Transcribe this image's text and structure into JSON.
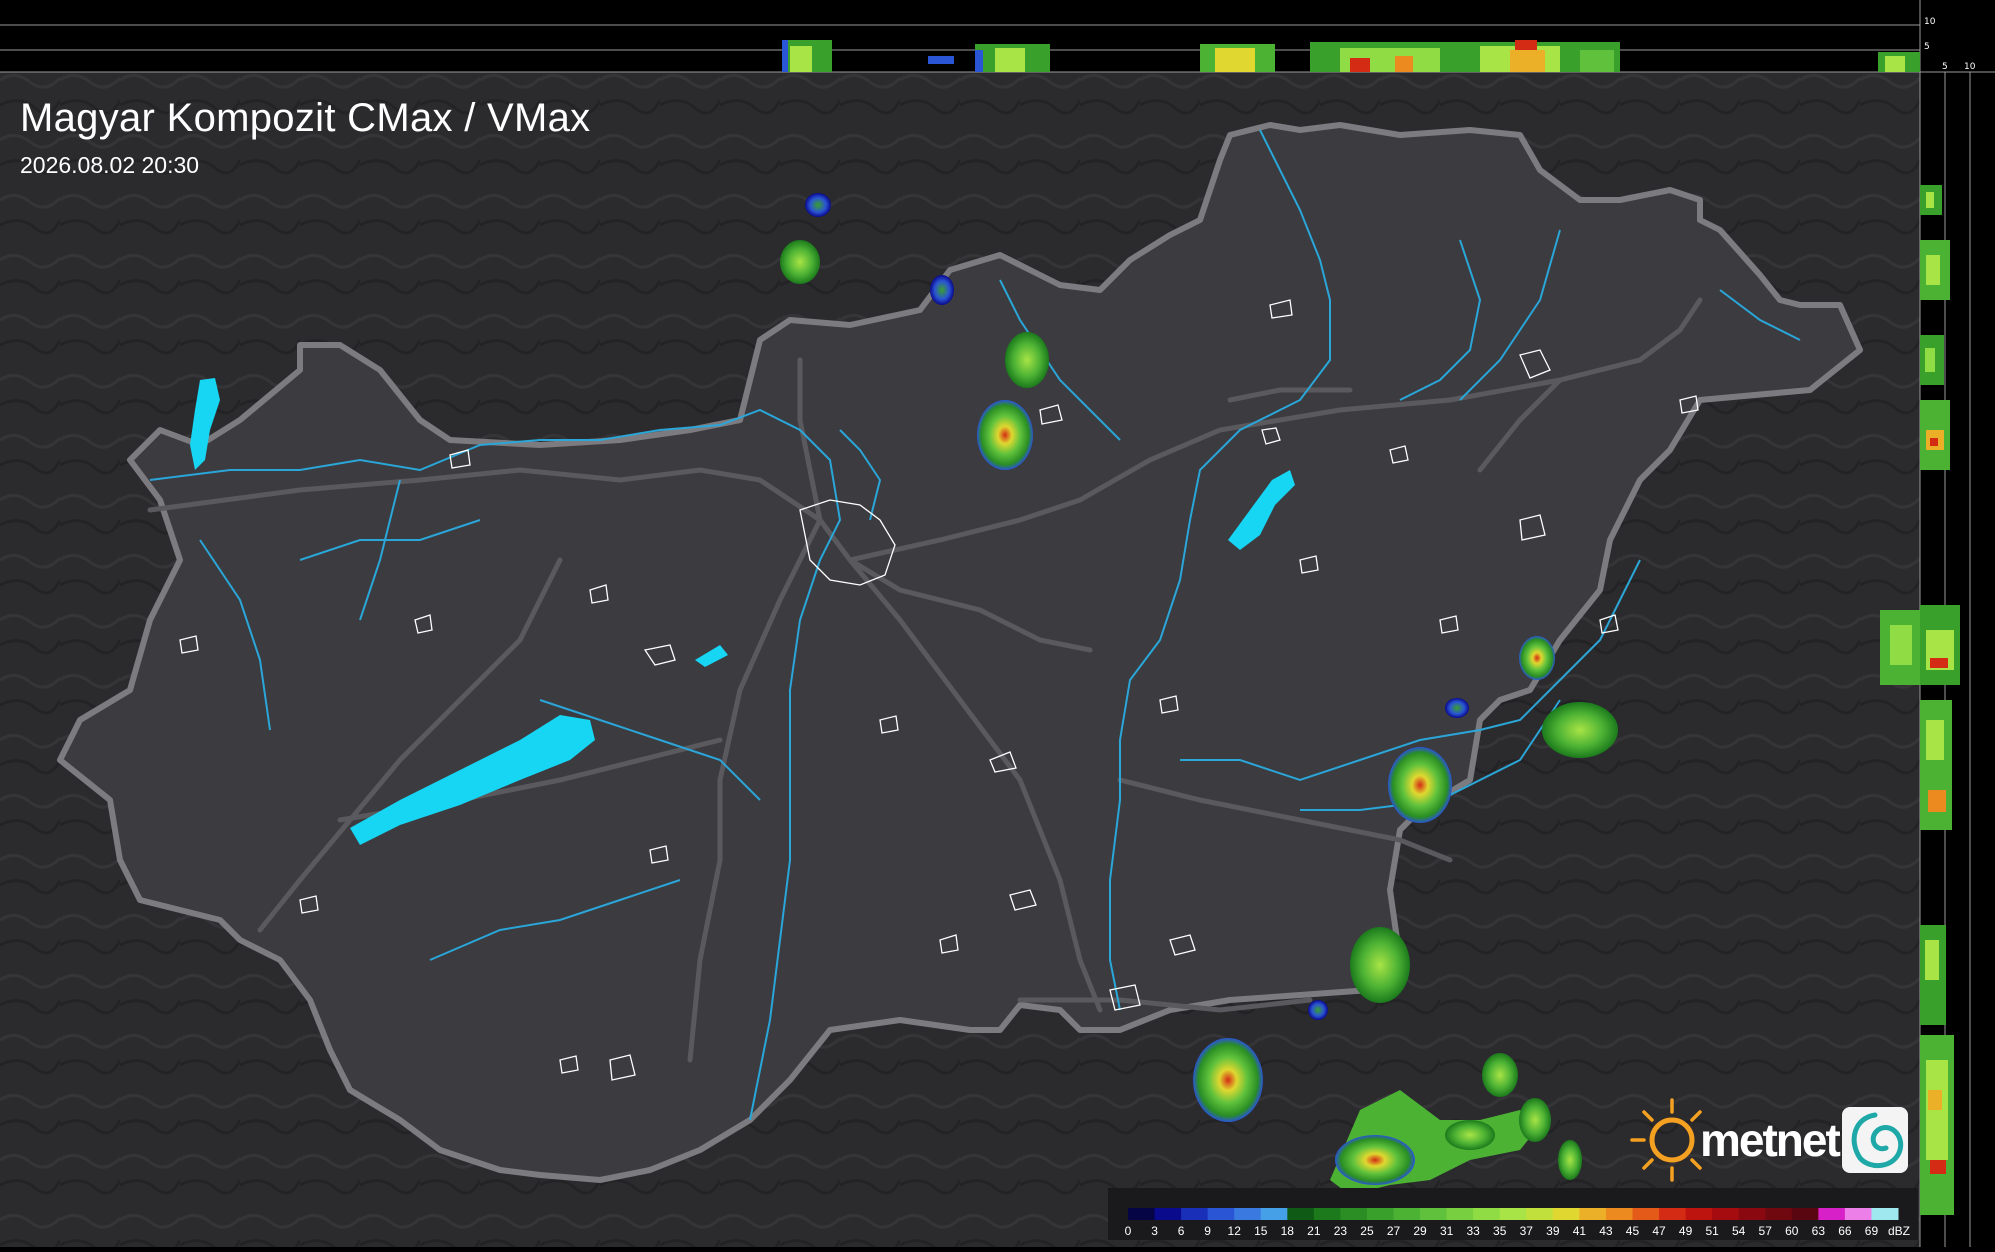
{
  "map": {
    "title": "Magyar Kompozit CMax / VMax",
    "timestamp": "2026.08.02 20:30"
  },
  "profile_top": {
    "scale_labels": [
      "10",
      "5"
    ]
  },
  "profile_right": {
    "scale_labels": [
      "5",
      "10"
    ]
  },
  "legend": {
    "unit": "dBZ",
    "levels": [
      "0",
      "3",
      "6",
      "9",
      "12",
      "15",
      "18",
      "21",
      "23",
      "25",
      "27",
      "29",
      "31",
      "33",
      "35",
      "37",
      "39",
      "41",
      "43",
      "45",
      "47",
      "49",
      "51",
      "54",
      "57",
      "60",
      "63",
      "66",
      "69"
    ],
    "colors": [
      "#050545",
      "#0a0a8c",
      "#1a2fb8",
      "#2a55d4",
      "#3a7ae0",
      "#46a0e8",
      "#0f5a14",
      "#1c7a1c",
      "#2a8e24",
      "#3aa02c",
      "#4cb234",
      "#60c23c",
      "#78d040",
      "#90dc44",
      "#a8e446",
      "#c2e03c",
      "#e0d830",
      "#ecb028",
      "#ec8a20",
      "#e45a18",
      "#d42c14",
      "#be1410",
      "#a40c10",
      "#8a0810",
      "#700810",
      "#5a0610",
      "#d820c8",
      "#ec80e8",
      "#a0e8f0"
    ]
  },
  "brand": {
    "name": "metnet",
    "sun_color": "#f4a020"
  },
  "colors": {
    "background": "#2a2a2c",
    "country": "#3a3a3e",
    "border": "#7a7a7e",
    "rivers": "#2aa6d8",
    "lakes": "#16d6f4",
    "settlements": "#ffffff"
  }
}
